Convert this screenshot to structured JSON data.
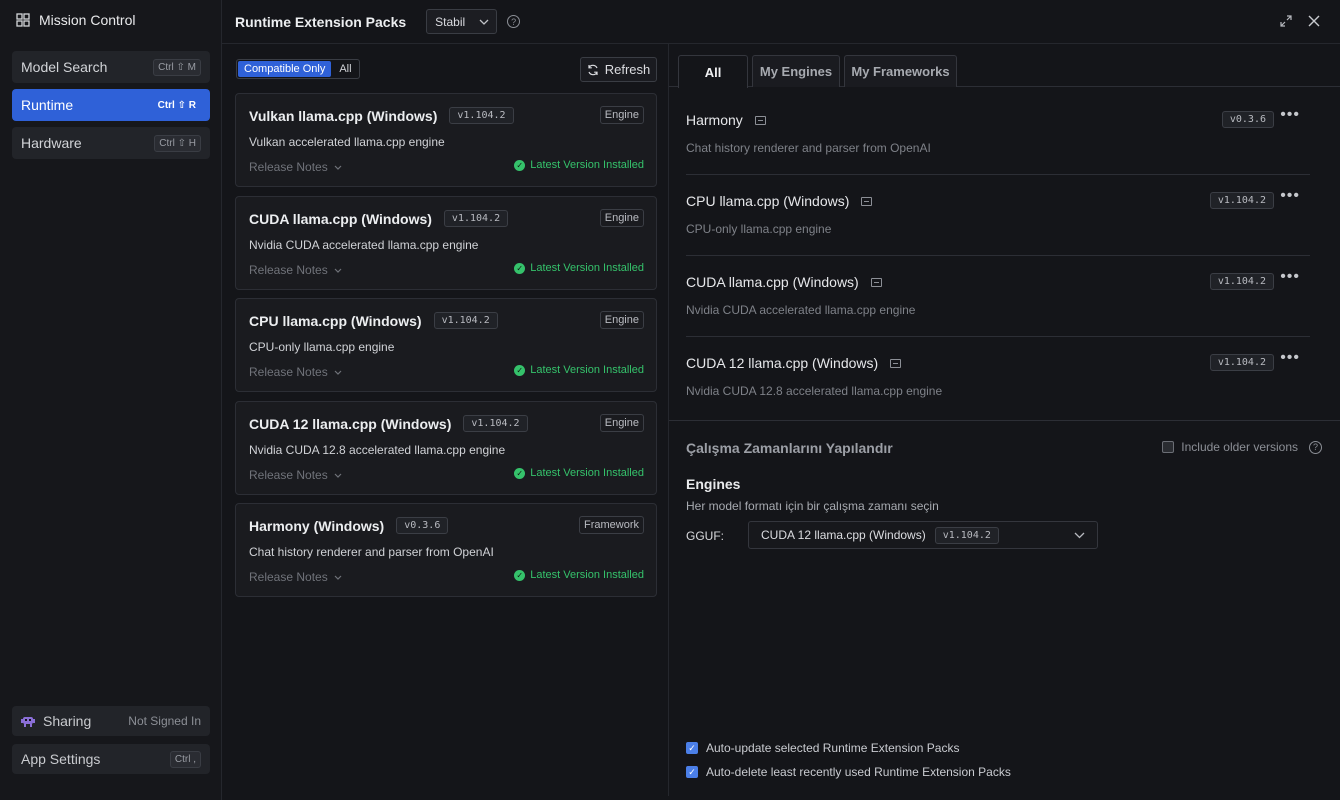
{
  "app": {
    "title": "Mission Control"
  },
  "sidebar": {
    "items": [
      {
        "label": "Model Search",
        "shortcut": "Ctrl ⇧ M"
      },
      {
        "label": "Runtime",
        "shortcut": "Ctrl ⇧ R"
      },
      {
        "label": "Hardware",
        "shortcut": "Ctrl ⇧ H"
      }
    ],
    "sharing": {
      "label": "Sharing",
      "status": "Not Signed In"
    },
    "settings": {
      "label": "App Settings",
      "shortcut": "Ctrl ,"
    }
  },
  "header": {
    "title": "Runtime Extension Packs",
    "channel": "Stabil"
  },
  "left": {
    "filter": {
      "compatible": "Compatible Only",
      "all": "All"
    },
    "refresh_label": "Refresh",
    "release_notes_label": "Release Notes",
    "installed_label": "Latest Version Installed",
    "packs": [
      {
        "name": "Vulkan llama.cpp (Windows)",
        "version": "v1.104.2",
        "type": "Engine",
        "desc": "Vulkan accelerated llama.cpp engine"
      },
      {
        "name": "CUDA llama.cpp (Windows)",
        "version": "v1.104.2",
        "type": "Engine",
        "desc": "Nvidia CUDA accelerated llama.cpp engine"
      },
      {
        "name": "CPU llama.cpp (Windows)",
        "version": "v1.104.2",
        "type": "Engine",
        "desc": "CPU-only llama.cpp engine"
      },
      {
        "name": "CUDA 12 llama.cpp (Windows)",
        "version": "v1.104.2",
        "type": "Engine",
        "desc": "Nvidia CUDA 12.8 accelerated llama.cpp engine"
      },
      {
        "name": "Harmony (Windows)",
        "version": "v0.3.6",
        "type": "Framework",
        "desc": "Chat history renderer and parser from OpenAI"
      }
    ]
  },
  "right": {
    "tabs": [
      "All",
      "My Engines",
      "My Frameworks"
    ],
    "engines": [
      {
        "name": "Harmony",
        "version": "v0.3.6",
        "desc": "Chat history renderer and parser from OpenAI"
      },
      {
        "name": "CPU llama.cpp (Windows)",
        "version": "v1.104.2",
        "desc": "CPU-only llama.cpp engine"
      },
      {
        "name": "CUDA llama.cpp (Windows)",
        "version": "v1.104.2",
        "desc": "Nvidia CUDA accelerated llama.cpp engine"
      },
      {
        "name": "CUDA 12 llama.cpp (Windows)",
        "version": "v1.104.2",
        "desc": "Nvidia CUDA 12.8 accelerated llama.cpp engine"
      }
    ],
    "config": {
      "title": "Çalışma Zamanlarını Yapılandır",
      "older_label": "Include older versions",
      "engines_heading": "Engines",
      "engines_sub": "Her model formatı için bir çalışma zamanı seçin",
      "gguf_label": "GGUF:",
      "gguf_value": "CUDA 12 llama.cpp (Windows)",
      "gguf_version": "v1.104.2"
    },
    "options": [
      {
        "label": "Auto-update selected Runtime Extension Packs",
        "checked": true
      },
      {
        "label": "Auto-delete least recently used Runtime Extension Packs",
        "checked": true
      }
    ]
  }
}
